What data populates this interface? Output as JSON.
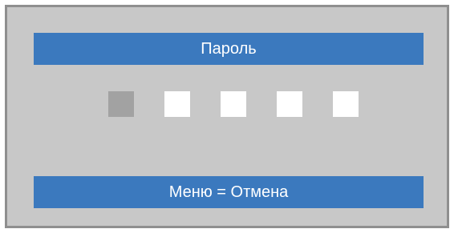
{
  "dialog": {
    "title": "Пароль",
    "footer": "Меню = Отмена"
  },
  "password": {
    "digit_count": 5,
    "active_index": 0
  }
}
